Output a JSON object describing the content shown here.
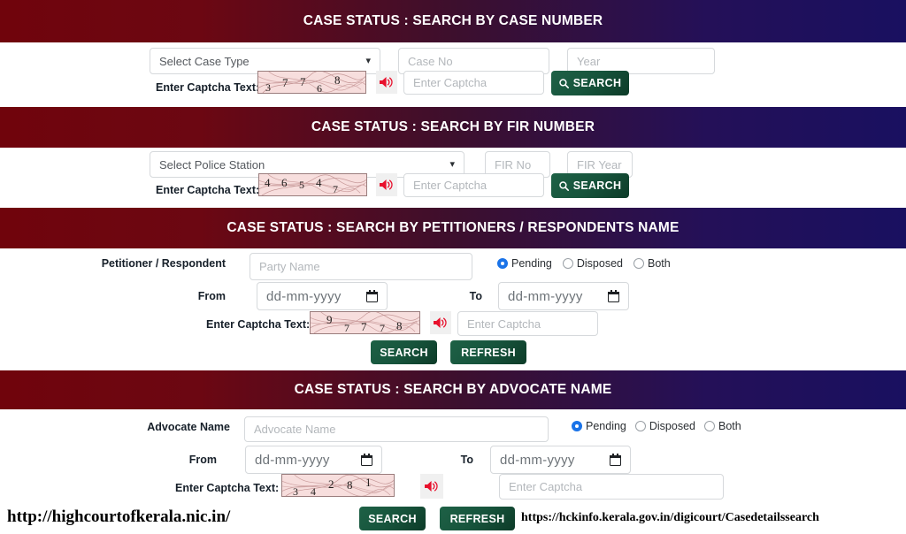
{
  "sections": [
    {
      "id": "case-number",
      "title": "CASE STATUS : SEARCH BY CASE NUMBER",
      "case_type_placeholder": "Select Case Type",
      "case_no_placeholder": "Case No",
      "year_placeholder": "Year",
      "captcha_label": "Enter Captcha Text:",
      "captcha_value": "37768",
      "captcha_input_placeholder": "Enter Captcha",
      "search_label": "SEARCH",
      "speaker_icon": "speaker-icon",
      "search_icon": "magnifier-icon"
    },
    {
      "id": "fir-number",
      "title": "CASE STATUS : SEARCH BY FIR NUMBER",
      "police_station_placeholder": "Select Police Station",
      "fir_no_placeholder": "FIR No",
      "fir_year_placeholder": "FIR Year",
      "captcha_label": "Enter Captcha Text:",
      "captcha_value": "46547",
      "captcha_input_placeholder": "Enter Captcha",
      "search_label": "SEARCH",
      "speaker_icon": "speaker-icon",
      "search_icon": "magnifier-icon"
    },
    {
      "id": "party-name",
      "title": "CASE STATUS : SEARCH BY PETITIONERS / RESPONDENTS NAME",
      "name_label": "Petitioner / Respondent",
      "name_placeholder": "Party Name",
      "from_label": "From",
      "to_label": "To",
      "date_placeholder": "dd-mm-yyyy",
      "status_options": [
        "Pending",
        "Disposed",
        "Both"
      ],
      "status_selected": "Pending",
      "captcha_label": "Enter Captcha Text:",
      "captcha_value": "97778",
      "captcha_input_placeholder": "Enter Captcha",
      "search_label": "SEARCH",
      "refresh_label": "REFRESH",
      "speaker_icon": "speaker-icon",
      "calendar_icon": "calendar-icon"
    },
    {
      "id": "advocate-name",
      "title": "CASE STATUS : SEARCH BY ADVOCATE NAME",
      "name_label": "Advocate Name",
      "name_placeholder": "Advocate Name",
      "from_label": "From",
      "to_label": "To",
      "date_placeholder": "dd-mm-yyyy",
      "status_options": [
        "Pending",
        "Disposed",
        "Both"
      ],
      "status_selected": "Pending",
      "captcha_label": "Enter Captcha Text:",
      "captcha_value": "34281",
      "captcha_input_placeholder": "Enter Captcha",
      "search_label": "SEARCH",
      "refresh_label": "REFRESH",
      "speaker_icon": "speaker-icon",
      "calendar_icon": "calendar-icon"
    }
  ],
  "footer": {
    "left_url": "http://highcourtofkerala.nic.in/",
    "right_url": "https://hckinfo.kerala.gov.in/digicourt/Casedetailssearch"
  },
  "colors": {
    "banner_start": "#70040c",
    "banner_mid": "#3d0f2d",
    "banner_end": "#191060",
    "button_green": "#17543c",
    "radio_blue": "#1a73e8",
    "speaker_red": "#e8112d",
    "captcha_bg": "#f7dedd"
  }
}
